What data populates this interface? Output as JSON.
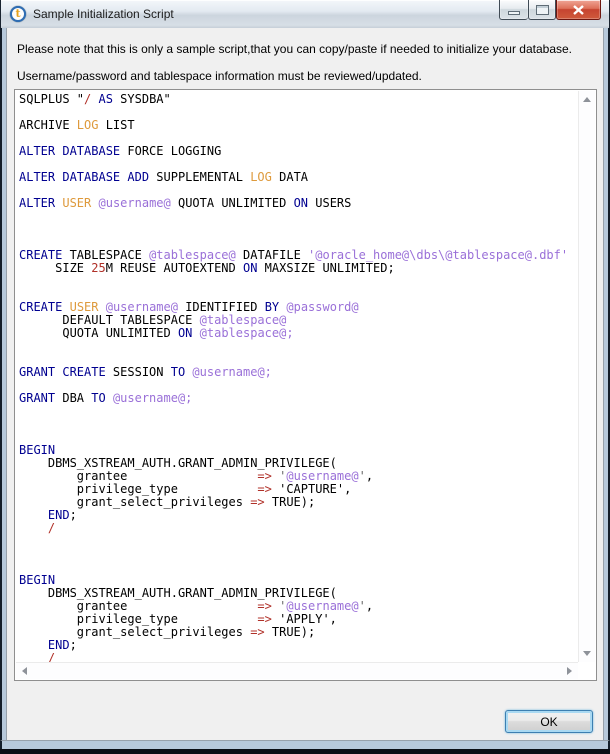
{
  "window": {
    "title": "Sample Initialization Script",
    "icon_letter": "t"
  },
  "intro": {
    "line1": "Please note that this is only a sample script,that you can copy/paste if needed to initialize your database.",
    "line2": "Username/password and tablespace information must be reviewed/updated."
  },
  "colors": {
    "k": "#000090",
    "o": "#de9a3c",
    "v": "#9a70d8",
    "r": "#b03028",
    "q": "#666666",
    "d": "#000000"
  },
  "script": {
    "lines": [
      [
        [
          "d",
          "SQLPLUS \""
        ],
        [
          "r",
          "/"
        ],
        [
          "d",
          " "
        ],
        [
          "k",
          "AS"
        ],
        [
          "d",
          " SYSDBA\""
        ]
      ],
      [],
      [
        [
          "d",
          "ARCHIVE "
        ],
        [
          "o",
          "LOG"
        ],
        [
          "d",
          " LIST"
        ]
      ],
      [],
      [
        [
          "k",
          "ALTER DATABASE"
        ],
        [
          "d",
          " FORCE LOGGING"
        ]
      ],
      [],
      [
        [
          "k",
          "ALTER DATABASE ADD"
        ],
        [
          "d",
          " SUPPLEMENTAL "
        ],
        [
          "o",
          "LOG"
        ],
        [
          "d",
          " DATA"
        ]
      ],
      [],
      [
        [
          "k",
          "ALTER"
        ],
        [
          "d",
          " "
        ],
        [
          "o",
          "USER"
        ],
        [
          "d",
          " "
        ],
        [
          "v",
          "@username@"
        ],
        [
          "d",
          " QUOTA UNLIMITED "
        ],
        [
          "k",
          "ON"
        ],
        [
          "d",
          " USERS"
        ]
      ],
      [],
      [],
      [],
      [
        [
          "k",
          "CREATE"
        ],
        [
          "d",
          " TABLESPACE "
        ],
        [
          "v",
          "@tablespace@"
        ],
        [
          "d",
          " DATAFILE "
        ],
        [
          "v",
          "'@oracle_home@\\dbs\\@tablespace@.dbf'"
        ]
      ],
      [
        [
          "d",
          "     SIZE "
        ],
        [
          "r",
          "25"
        ],
        [
          "d",
          "M REUSE AUTOEXTEND "
        ],
        [
          "k",
          "ON"
        ],
        [
          "d",
          " MAXSIZE UNLIMITED;"
        ]
      ],
      [],
      [],
      [
        [
          "k",
          "CREATE"
        ],
        [
          "d",
          " "
        ],
        [
          "o",
          "USER"
        ],
        [
          "d",
          " "
        ],
        [
          "v",
          "@username@"
        ],
        [
          "d",
          " IDENTIFIED "
        ],
        [
          "k",
          "BY"
        ],
        [
          "d",
          " "
        ],
        [
          "v",
          "@password@"
        ]
      ],
      [
        [
          "d",
          "      DEFAULT TABLESPACE "
        ],
        [
          "v",
          "@tablespace@"
        ]
      ],
      [
        [
          "d",
          "      QUOTA UNLIMITED "
        ],
        [
          "k",
          "ON"
        ],
        [
          "d",
          " "
        ],
        [
          "v",
          "@tablespace@;"
        ]
      ],
      [],
      [],
      [
        [
          "k",
          "GRANT CREATE"
        ],
        [
          "d",
          " SESSION "
        ],
        [
          "k",
          "TO"
        ],
        [
          "d",
          " "
        ],
        [
          "v",
          "@username@;"
        ]
      ],
      [],
      [
        [
          "k",
          "GRANT"
        ],
        [
          "d",
          " DBA "
        ],
        [
          "k",
          "TO"
        ],
        [
          "d",
          " "
        ],
        [
          "v",
          "@username@;"
        ]
      ],
      [],
      [],
      [],
      [
        [
          "k",
          "BEGIN"
        ]
      ],
      [
        [
          "d",
          "    DBMS_XSTREAM_AUTH.GRANT_ADMIN_PRIVILEGE("
        ]
      ],
      [
        [
          "d",
          "        grantee                  "
        ],
        [
          "r",
          "=>"
        ],
        [
          "d",
          " "
        ],
        [
          "q",
          "'"
        ],
        [
          "v",
          "@username@"
        ],
        [
          "q",
          "'"
        ],
        [
          "d",
          ","
        ]
      ],
      [
        [
          "d",
          "        privilege_type           "
        ],
        [
          "r",
          "=>"
        ],
        [
          "d",
          " 'CAPTURE',"
        ]
      ],
      [
        [
          "d",
          "        grant_select_privileges "
        ],
        [
          "r",
          "=>"
        ],
        [
          "d",
          " TRUE);"
        ]
      ],
      [
        [
          "d",
          "    "
        ],
        [
          "k",
          "END"
        ],
        [
          "d",
          ";"
        ]
      ],
      [
        [
          "d",
          "    "
        ],
        [
          "r",
          "/"
        ]
      ],
      [],
      [],
      [],
      [
        [
          "k",
          "BEGIN"
        ]
      ],
      [
        [
          "d",
          "    DBMS_XSTREAM_AUTH.GRANT_ADMIN_PRIVILEGE("
        ]
      ],
      [
        [
          "d",
          "        grantee                  "
        ],
        [
          "r",
          "=>"
        ],
        [
          "d",
          " "
        ],
        [
          "q",
          "'"
        ],
        [
          "v",
          "@username@"
        ],
        [
          "q",
          "'"
        ],
        [
          "d",
          ","
        ]
      ],
      [
        [
          "d",
          "        privilege_type           "
        ],
        [
          "r",
          "=>"
        ],
        [
          "d",
          " 'APPLY',"
        ]
      ],
      [
        [
          "d",
          "        grant_select_privileges "
        ],
        [
          "r",
          "=>"
        ],
        [
          "d",
          " TRUE);"
        ]
      ],
      [
        [
          "d",
          "    "
        ],
        [
          "k",
          "END"
        ],
        [
          "d",
          ";"
        ]
      ],
      [
        [
          "d",
          "    "
        ],
        [
          "r",
          "/"
        ]
      ]
    ]
  },
  "footer": {
    "ok": "OK"
  }
}
